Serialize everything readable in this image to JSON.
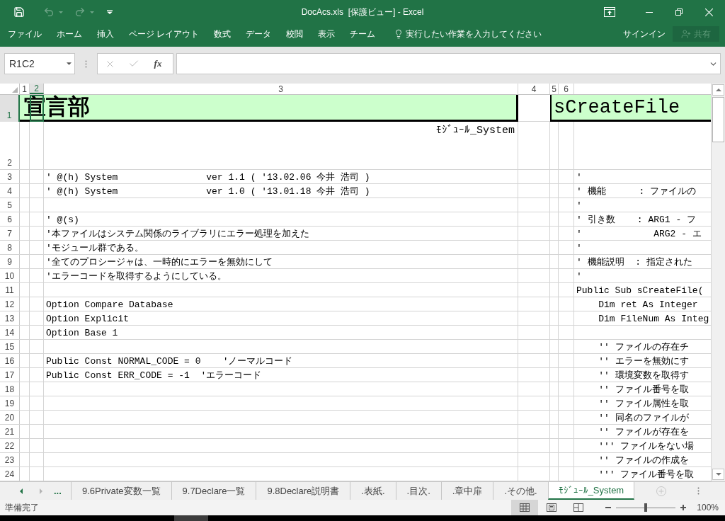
{
  "window": {
    "title": "DocAcs.xls  [保護ビュー] - Excel"
  },
  "quick_access": [
    {
      "kind": "save",
      "disabled": false
    },
    {
      "kind": "undo",
      "disabled": true
    },
    {
      "kind": "redo",
      "disabled": true
    },
    {
      "kind": "customize",
      "disabled": false
    }
  ],
  "ribbon": {
    "tabs": [
      "ファイル",
      "ホーム",
      "挿入",
      "ページ レイアウト",
      "数式",
      "データ",
      "校閲",
      "表示",
      "チーム"
    ],
    "tell_me": {
      "placeholder": "実行したい作業を入力してください"
    },
    "sign_in": "サインイン",
    "share": {
      "label": "共有",
      "disabled": true
    }
  },
  "formula_bar": {
    "name_box": "R1C2",
    "buttons": [
      {
        "kind": "cancel",
        "disabled": true
      },
      {
        "kind": "enter",
        "disabled": true
      },
      {
        "kind": "function",
        "label": "fx",
        "disabled": false
      }
    ]
  },
  "sheet": {
    "columns": [
      {
        "label": "1",
        "selected": false
      },
      {
        "label": "2",
        "selected": true
      },
      {
        "label": "3",
        "selected": false
      },
      {
        "label": "4",
        "selected": false
      },
      {
        "label": "5",
        "selected": false
      },
      {
        "label": "6",
        "selected": false
      }
    ],
    "rows": [
      {
        "label": "1",
        "selected": true,
        "kind": "heading",
        "col_1": "宣言部",
        "col_5": "sCreateFile"
      },
      {
        "label": "2",
        "selected": false,
        "kind": "note",
        "col_3": "ﾓｼﾞｭｰﾙ_System"
      },
      {
        "label": "3",
        "selected": false,
        "kind": "code",
        "col_3": "' @(h) System                ver 1.1 ( '13.02.06 今井 浩司 )",
        "col_7": "'"
      },
      {
        "label": "4",
        "selected": false,
        "kind": "code",
        "col_3": "' @(h) System                ver 1.0 ( '13.01.18 今井 浩司 )",
        "col_7": "' 機能      : ファイルの"
      },
      {
        "label": "5",
        "selected": false,
        "kind": "code",
        "col_7": "'"
      },
      {
        "label": "6",
        "selected": false,
        "kind": "code",
        "col_3": "' @(s)",
        "col_7": "' 引き数    : ARG1 - フ"
      },
      {
        "label": "7",
        "selected": false,
        "kind": "code",
        "col_3": "'本ファイルはシステム関係のライブラリにエラー処理を加えた",
        "col_7": "'             ARG2 - エ"
      },
      {
        "label": "8",
        "selected": false,
        "kind": "code",
        "col_3": "'モジュール群である。",
        "col_7": "'"
      },
      {
        "label": "9",
        "selected": false,
        "kind": "code",
        "col_3": "'全てのプロシージャは、一時的にエラーを無効にして",
        "col_7": "' 機能説明  : 指定された"
      },
      {
        "label": "10",
        "selected": false,
        "kind": "code",
        "col_3": "'エラーコードを取得するようにしている。",
        "col_7": "'"
      },
      {
        "label": "11",
        "selected": false,
        "kind": "code",
        "col_7": "Public Sub sCreateFile("
      },
      {
        "label": "12",
        "selected": false,
        "kind": "code",
        "col_3": "Option Compare Database",
        "col_7": "    Dim ret As Integer"
      },
      {
        "label": "13",
        "selected": false,
        "kind": "code",
        "col_3": "Option Explicit",
        "col_7": "    Dim FileNum As Integ"
      },
      {
        "label": "14",
        "selected": false,
        "kind": "code",
        "col_3": "Option Base 1"
      },
      {
        "label": "15",
        "selected": false,
        "kind": "code",
        "col_7": "    '' ファイルの存在チ"
      },
      {
        "label": "16",
        "selected": false,
        "kind": "code",
        "col_3": "Public Const NORMAL_CODE = 0    'ノーマルコード",
        "col_7": "    '' エラーを無効にす"
      },
      {
        "label": "17",
        "selected": false,
        "kind": "code",
        "col_3": "Public Const ERR_CODE = -1  'エラーコード",
        "col_7": "    '' 環境変数を取得す"
      },
      {
        "label": "18",
        "selected": false,
        "kind": "code",
        "col_7": "    '' ファイル番号を取"
      },
      {
        "label": "19",
        "selected": false,
        "kind": "code",
        "col_7": "    '' ファイル属性を取"
      },
      {
        "label": "20",
        "selected": false,
        "kind": "code",
        "col_7": "    '' 同名のファイルが"
      },
      {
        "label": "21",
        "selected": false,
        "kind": "code",
        "col_7": "    '' ファイルが存在を"
      },
      {
        "label": "22",
        "selected": false,
        "kind": "code",
        "col_7": "    ''' ファイルをない場"
      },
      {
        "label": "23",
        "selected": false,
        "kind": "code",
        "col_7": "    '' ファイルの作成を"
      },
      {
        "label": "24",
        "selected": false,
        "kind": "code",
        "col_7": "    ''' ファイル番号を取"
      }
    ]
  },
  "sheet_tabs": {
    "scroll": [
      {
        "kind": "prev",
        "disabled": false
      },
      {
        "kind": "next",
        "disabled": true
      }
    ],
    "more": "...",
    "tabs": [
      {
        "label": "9.6Private変数一覧",
        "selected": false
      },
      {
        "label": "9.7Declare一覧",
        "selected": false
      },
      {
        "label": "9.8Declare説明書",
        "selected": false
      },
      {
        "label": ".表紙.",
        "selected": false
      },
      {
        "label": ".目次.",
        "selected": false
      },
      {
        "label": ".章中扉",
        "selected": false
      },
      {
        "label": ".その他.",
        "selected": false
      },
      {
        "label": "ﾓｼﾞｭｰﾙ_System",
        "selected": true
      }
    ],
    "add_sheet": {
      "disabled": true
    }
  },
  "status_bar": {
    "status": "準備完了",
    "views": [
      {
        "kind": "normal",
        "selected": true
      },
      {
        "kind": "page-layout",
        "selected": false
      },
      {
        "kind": "page-break",
        "selected": false
      }
    ],
    "zoom": {
      "level": 0.5,
      "reading": "100%"
    }
  }
}
